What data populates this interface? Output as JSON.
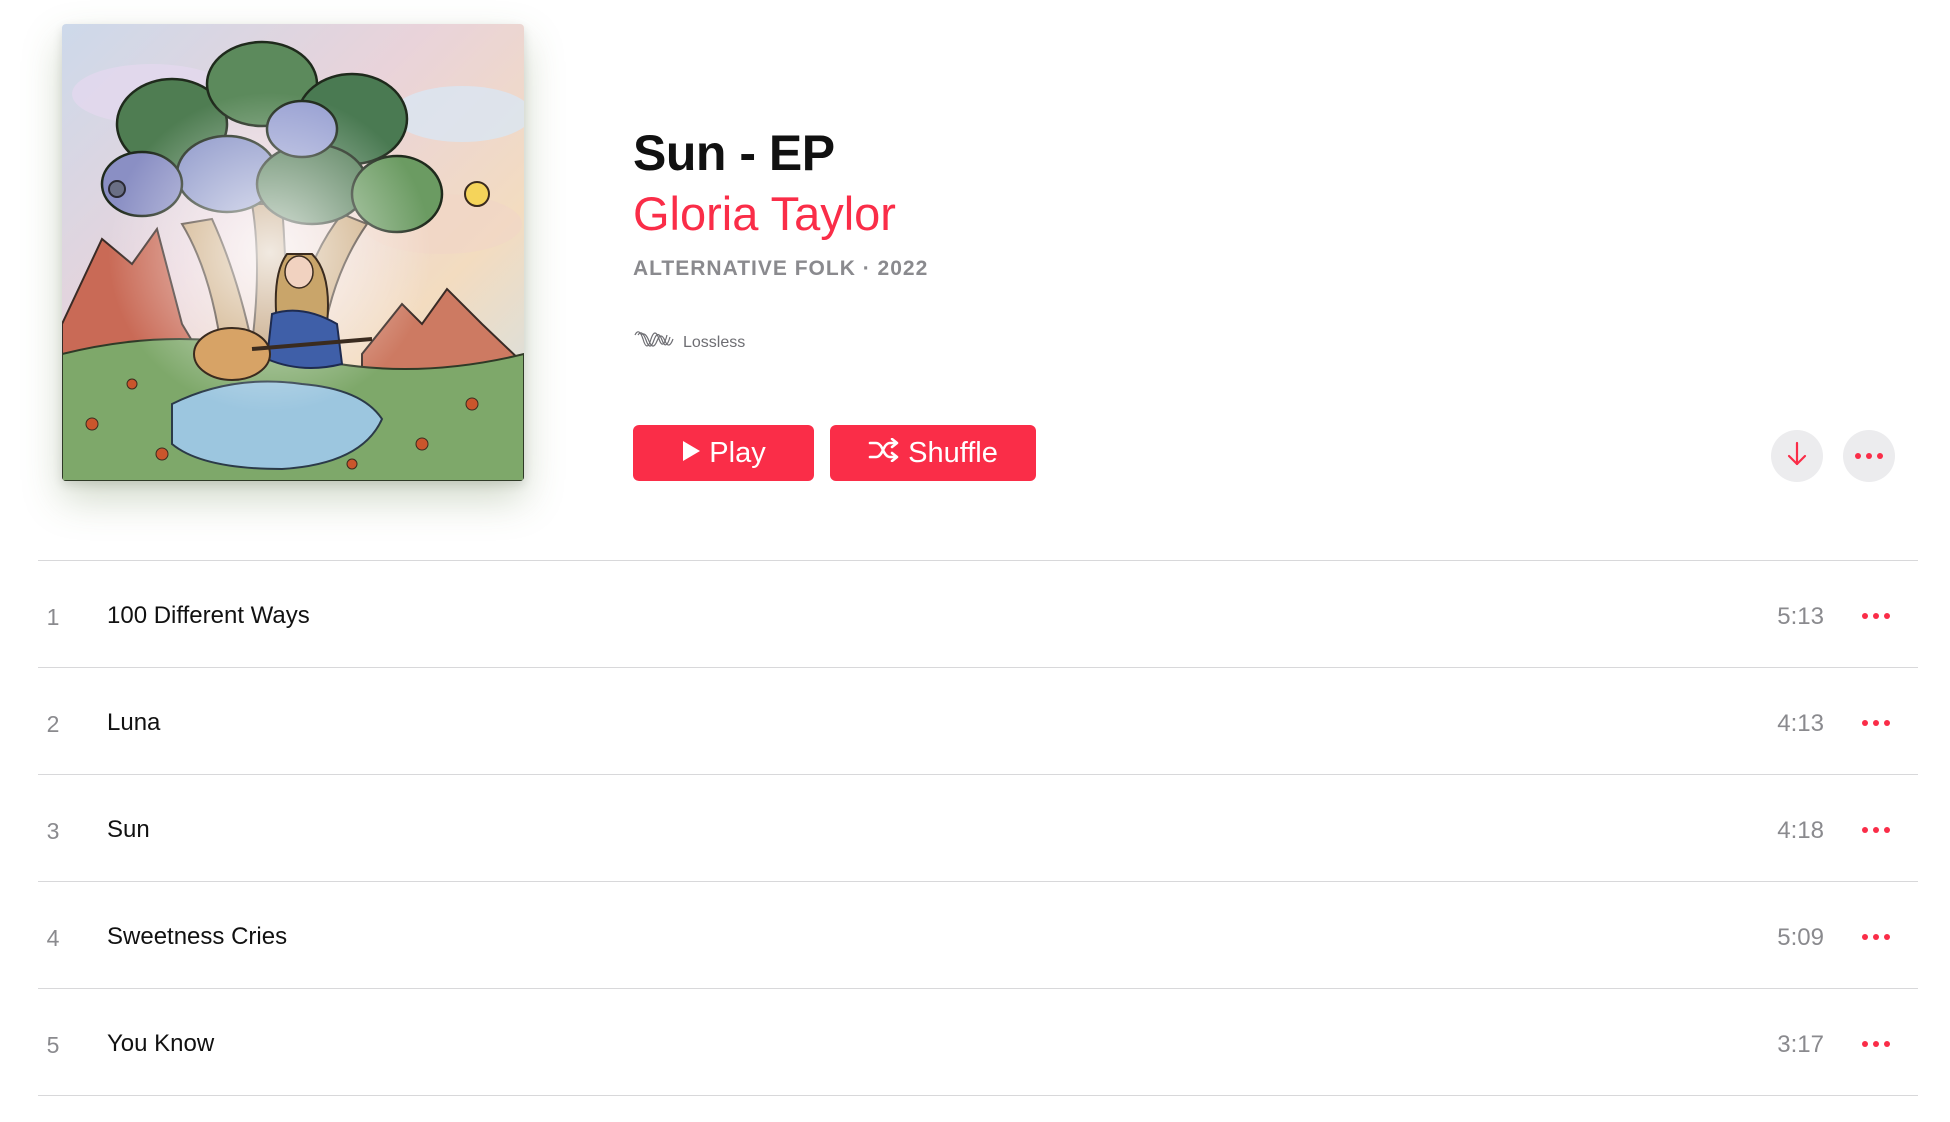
{
  "album": {
    "title": "Sun - EP",
    "artist": "Gloria Taylor",
    "meta": "ALTERNATIVE FOLK · 2022",
    "badge": "Lossless",
    "artwork_icon": "album-artwork-image"
  },
  "actions": {
    "play_label": "Play",
    "shuffle_label": "Shuffle",
    "download_icon": "download-arrow-icon",
    "more_icon": "ellipsis-icon"
  },
  "tracks": [
    {
      "number": "1",
      "title": "100 Different Ways",
      "duration": "5:13"
    },
    {
      "number": "2",
      "title": "Luna",
      "duration": "4:13"
    },
    {
      "number": "3",
      "title": "Sun",
      "duration": "4:18"
    },
    {
      "number": "4",
      "title": "Sweetness Cries",
      "duration": "5:09"
    },
    {
      "number": "5",
      "title": "You Know",
      "duration": "3:17"
    }
  ],
  "colors": {
    "accent": "#fa2d48",
    "secondary_text": "#8a8a8e",
    "button_bg": "#ececee",
    "divider": "#d8d8da"
  }
}
